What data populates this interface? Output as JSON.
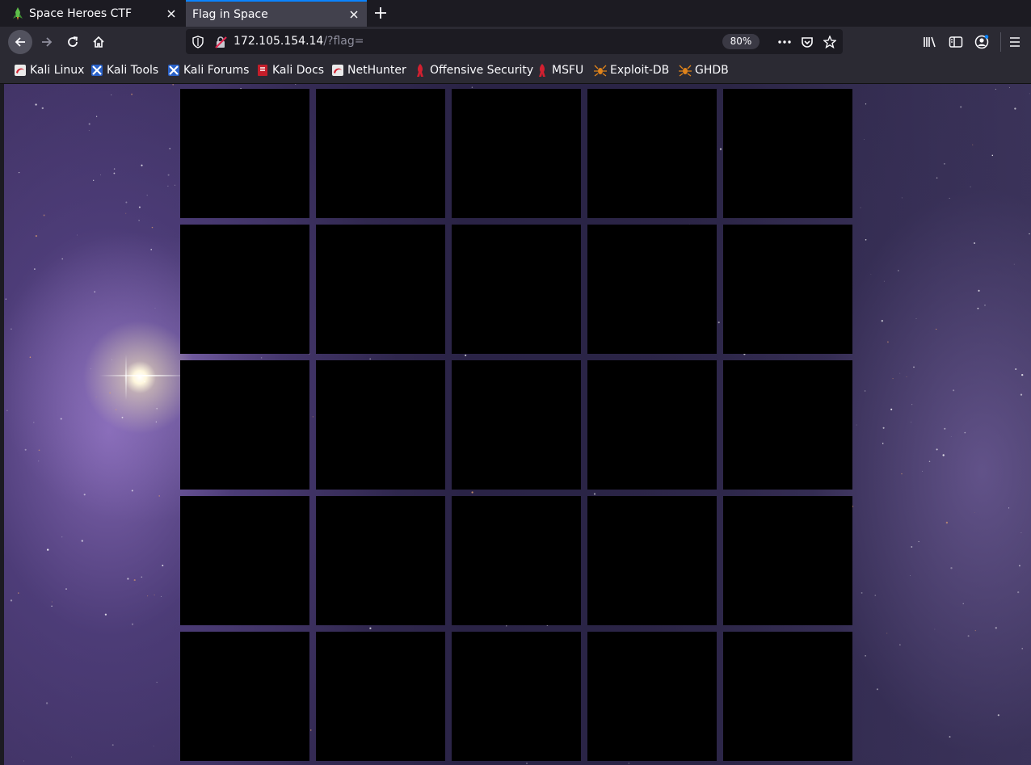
{
  "tabs": [
    {
      "title": "Space Heroes CTF",
      "active": false
    },
    {
      "title": "Flag in Space",
      "active": true
    }
  ],
  "url": {
    "host": "172.105.154.14",
    "path": "/?flag=",
    "zoom": "80%"
  },
  "bookmarks": [
    {
      "label": "Kali Linux",
      "icon": "kali-dragon-icon"
    },
    {
      "label": "Kali Tools",
      "icon": "kali-tools-icon"
    },
    {
      "label": "Kali Forums",
      "icon": "kali-tools-icon"
    },
    {
      "label": "Kali Docs",
      "icon": "kali-docs-icon"
    },
    {
      "label": "NetHunter",
      "icon": "kali-dragon-icon"
    },
    {
      "label": "Offensive Security",
      "icon": "offsec-icon"
    },
    {
      "label": "MSFU",
      "icon": "offsec-icon"
    },
    {
      "label": "Exploit-DB",
      "icon": "exploitdb-spider-icon"
    },
    {
      "label": "GHDB",
      "icon": "exploitdb-spider-icon"
    }
  ],
  "colors": {
    "accent": "#0a84ff",
    "tile": "#000000",
    "space_purple": "#3e3160"
  }
}
